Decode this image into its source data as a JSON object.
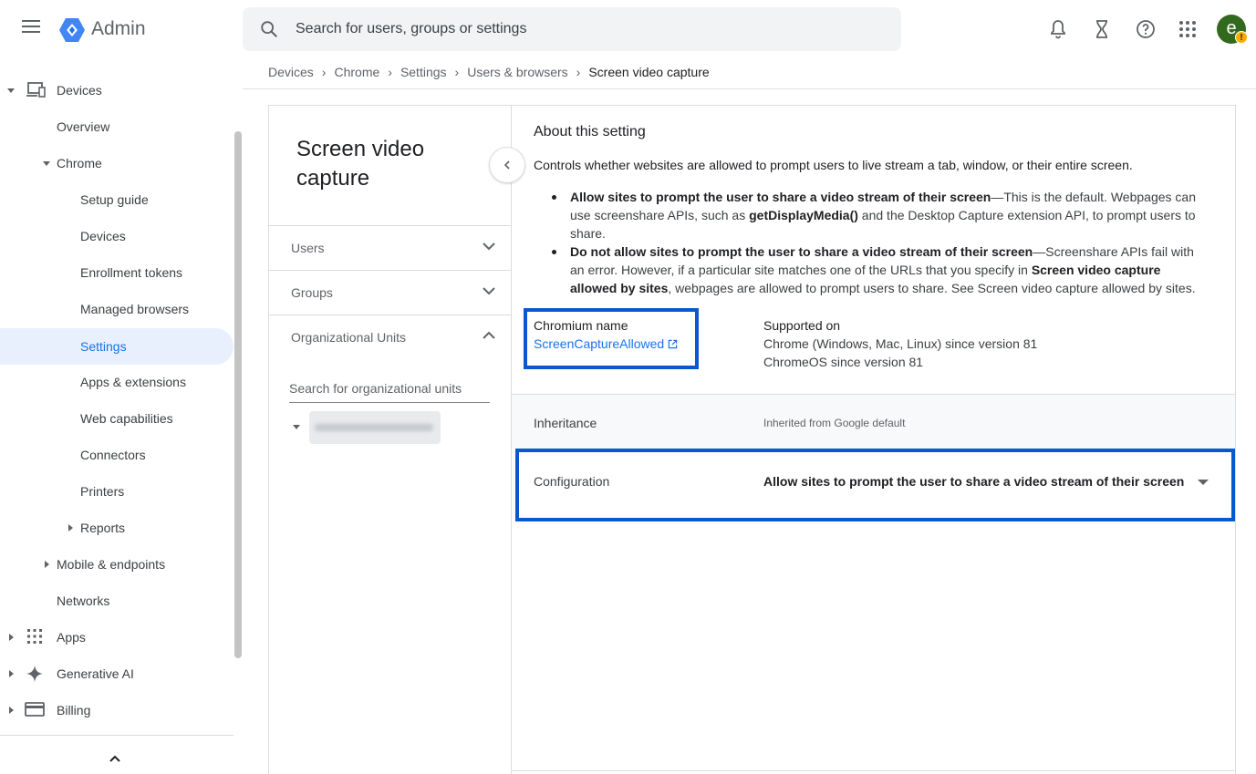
{
  "app": {
    "title": "Admin"
  },
  "search": {
    "placeholder": "Search for users, groups or settings"
  },
  "user": {
    "avatar_letter": "e",
    "badge": "!"
  },
  "sidebar": {
    "devices": "Devices",
    "overview": "Overview",
    "chrome": "Chrome",
    "setup_guide": "Setup guide",
    "chrome_devices": "Devices",
    "enrollment_tokens": "Enrollment tokens",
    "managed_browsers": "Managed browsers",
    "settings": "Settings",
    "apps_extensions": "Apps & extensions",
    "web_capabilities": "Web capabilities",
    "connectors": "Connectors",
    "printers": "Printers",
    "reports": "Reports",
    "mobile_endpoints": "Mobile & endpoints",
    "networks": "Networks",
    "apps": "Apps",
    "generative_ai": "Generative AI",
    "billing": "Billing"
  },
  "breadcrumb": [
    "Devices",
    "Chrome",
    "Settings",
    "Users & browsers",
    "Screen video capture"
  ],
  "left_panel": {
    "title": "Screen video capture",
    "users": "Users",
    "groups": "Groups",
    "org_units": "Organizational Units",
    "ou_search_placeholder": "Search for organizational units"
  },
  "about": {
    "title": "About this setting",
    "description": "Controls whether websites are allowed to prompt users to live stream a tab, window, or their entire screen.",
    "bullet1_bold": "Allow sites to prompt the user to share a video stream of their screen",
    "bullet1_a": "—This is the default. Webpages can use screenshare APIs, such as ",
    "bullet1_api": "getDisplayMedia()",
    "bullet1_b": " and the Desktop Capture extension API, to prompt users to share.",
    "bullet2_bold": "Do not allow sites to prompt the user to share a video stream of their screen",
    "bullet2_a": "—Screenshare APIs fail with an error. However, if a particular site matches one of the URLs that you specify in ",
    "bullet2_bold2": "Screen video capture allowed by sites",
    "bullet2_b": ", webpages are allowed to prompt users to share. See Screen video capture allowed by sites.",
    "chromium_label": "Chromium name",
    "chromium_link": "ScreenCaptureAllowed",
    "supported_label": "Supported on",
    "supported_1": "Chrome (Windows, Mac, Linux) since version 81",
    "supported_2": "ChromeOS since version 81"
  },
  "inheritance": {
    "label": "Inheritance",
    "value": "Inherited from Google default"
  },
  "configuration": {
    "label": "Configuration",
    "value": "Allow sites to prompt the user to share a video stream of their screen"
  }
}
